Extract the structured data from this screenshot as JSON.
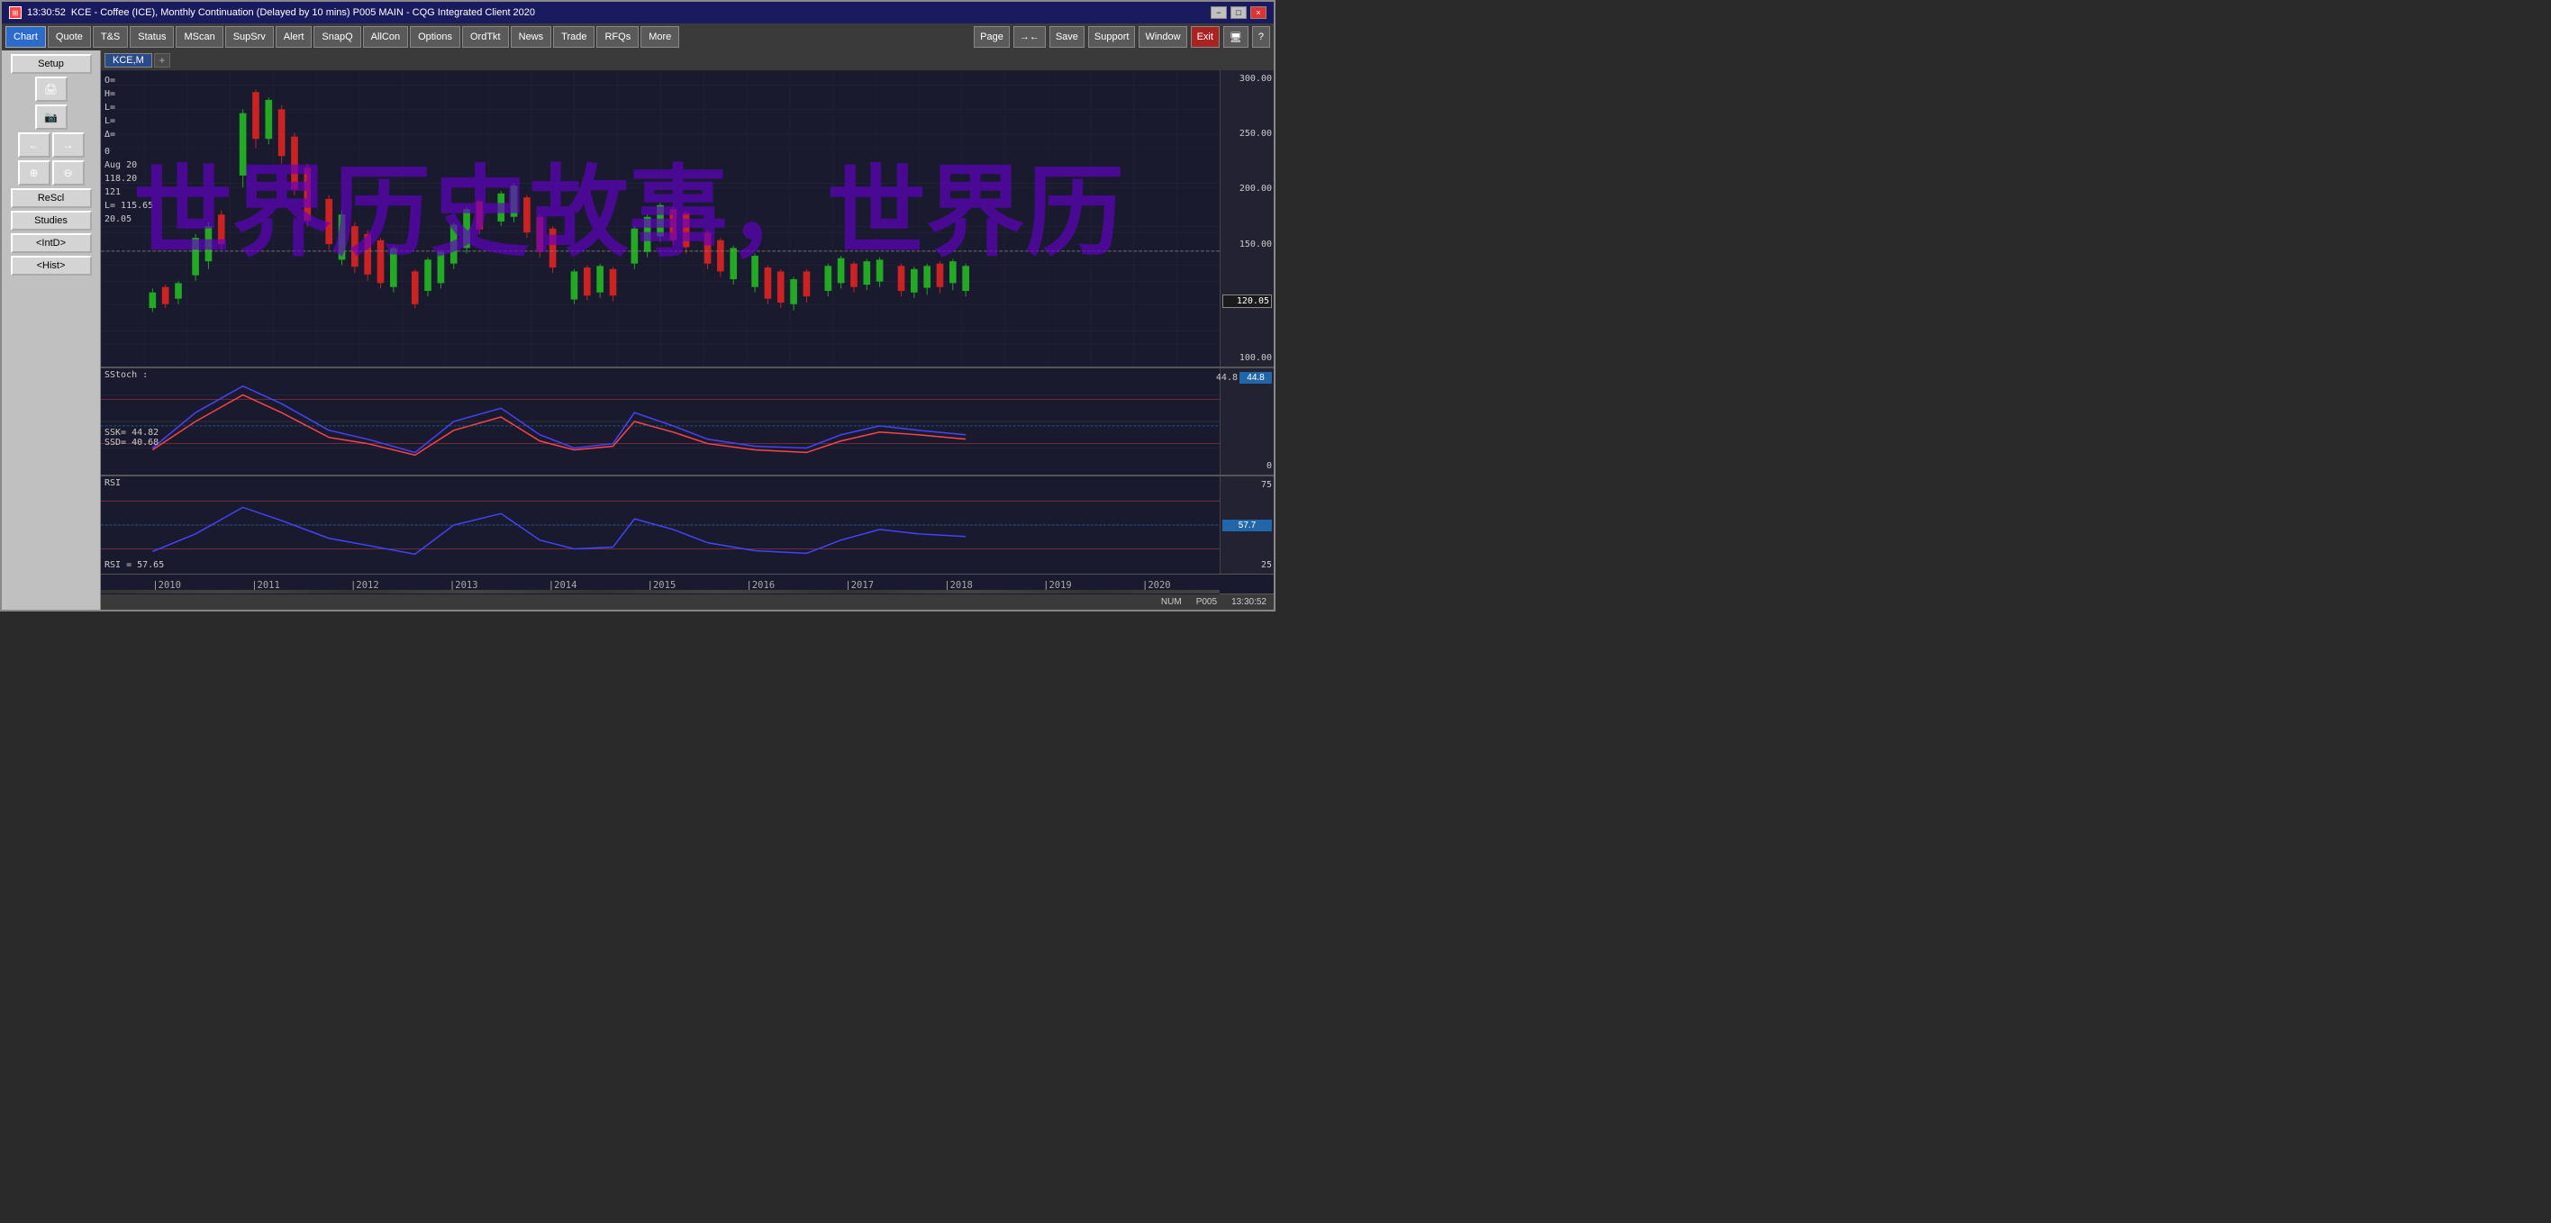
{
  "title_bar": {
    "time": "13:30:52",
    "title": "KCE - Coffee (ICE), Monthly Continuation (Delayed by 10 mins)  P005 MAIN - CQG Integrated Client 2020",
    "min_btn": "−",
    "max_btn": "□",
    "close_btn": "×"
  },
  "menu": {
    "items": [
      "Chart",
      "Quote",
      "T&S",
      "Status",
      "MScan",
      "SupSrv",
      "Alert",
      "SnapQ",
      "AllCon",
      "Options",
      "OrdTkt",
      "News",
      "Trade",
      "RFQs",
      "More"
    ],
    "right_items": [
      "Page",
      "→←",
      "Save",
      "Support",
      "Window",
      "Exit",
      "🖥",
      "?"
    ]
  },
  "sidebar": {
    "setup": "Setup",
    "rescl": "ReScl",
    "studies": "Studies",
    "intd": "<IntD>",
    "hist": "<Hist>"
  },
  "chart_tab": {
    "name": "KCE,M",
    "add": "+"
  },
  "ohlc": {
    "o": "O=",
    "h": "H=",
    "l": "L=",
    "l2": "L=",
    "delta": "Δ=",
    "aug_label": "Aug 20",
    "o_val": "",
    "h_val": "118.20",
    "l_val": "121",
    "l2_val": "115.65",
    "delta_val": "20.05"
  },
  "price_scale": {
    "values": [
      "300.00",
      "250.00",
      "200.00",
      "150.00",
      "120.05",
      "100.00"
    ]
  },
  "stochastic": {
    "label": "SStoch :",
    "ssk_label": "SSK=",
    "ssk_val": "44.82",
    "ssd_label": "SSD=",
    "ssd_val": "40.68",
    "scale_values": [
      "44.8",
      "0"
    ]
  },
  "rsi": {
    "label": "RSI",
    "rs_label": "RSI =",
    "rs_val": "57.65",
    "scale_values": [
      "75",
      "57.7",
      "25"
    ]
  },
  "time_axis": {
    "years": [
      "|2010",
      "|2011",
      "|2012",
      "|2013",
      "|2014",
      "|2015",
      "|2016",
      "|2017",
      "|2018",
      "|2019",
      "|2020"
    ]
  },
  "status_bar": {
    "num": "NUM",
    "page": "P005",
    "time": "13:30:52"
  },
  "watermark": "世界历史故事，世界历",
  "colors": {
    "bg": "#1a1a2e",
    "grid": "#2a2a4a",
    "candle_up": "#22aa22",
    "candle_down": "#cc2222",
    "stoch_k": "#4444ff",
    "stoch_d": "#ff4444",
    "rsi_line": "#4444ff",
    "watermark": "rgba(100, 0, 200, 0.65)"
  }
}
